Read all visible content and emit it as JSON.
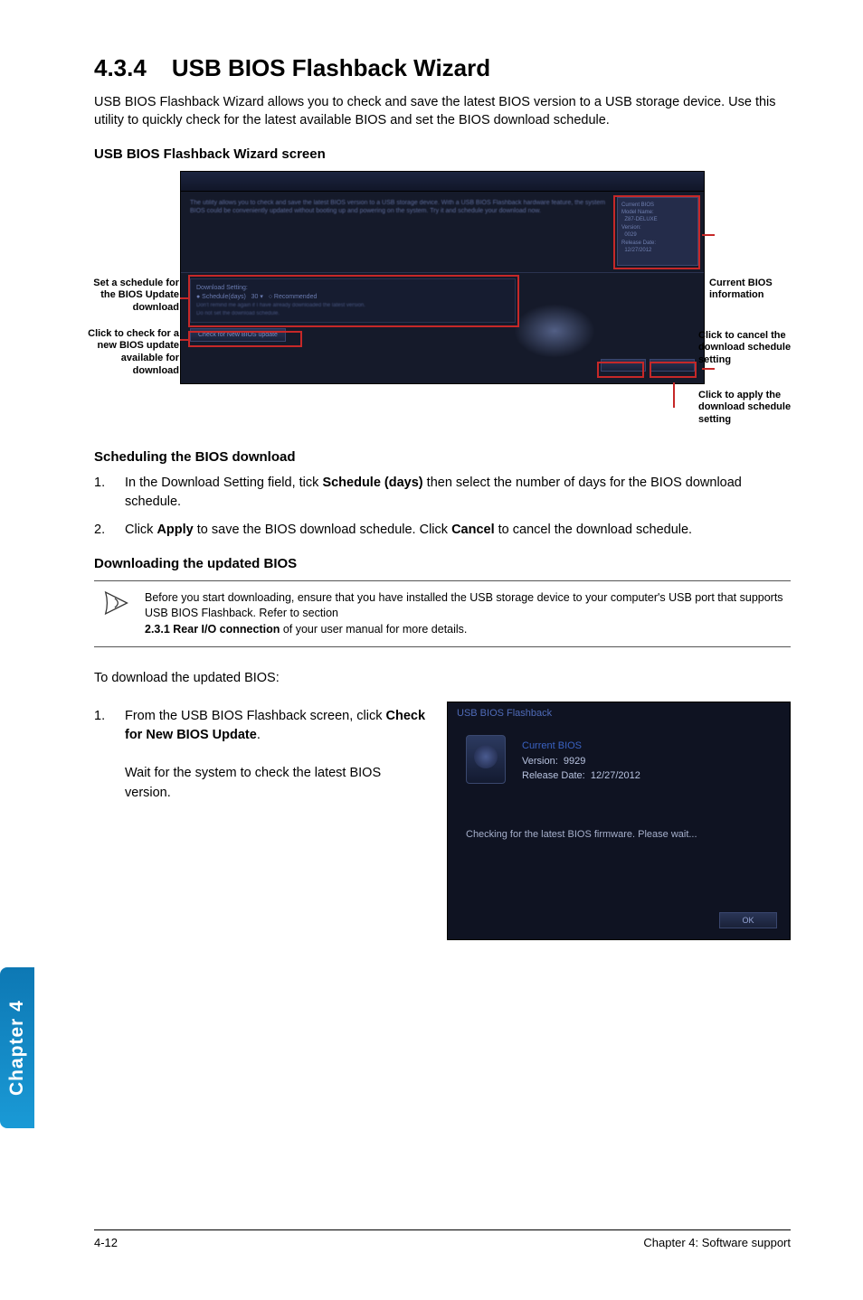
{
  "section": {
    "number": "4.3.4",
    "title": "USB BIOS Flashback Wizard",
    "intro": "USB BIOS Flashback Wizard allows you to check and save the latest BIOS version to a USB storage device. Use this utility to quickly check for the latest available BIOS and set the BIOS download schedule."
  },
  "screenshot1": {
    "heading": "USB BIOS Flashback Wizard screen",
    "labels": {
      "left1": "Set a schedule for the BIOS Update download",
      "left2": "Click to check for a new BIOS update available for download",
      "right1": "Current BIOS information",
      "right2": "Click to cancel the download schedule setting",
      "right3": "Click to apply the download schedule setting"
    }
  },
  "scheduling": {
    "heading": "Scheduling the BIOS download",
    "step1_prefix": "In the Download Setting field, tick ",
    "step1_bold": "Schedule (days)",
    "step1_suffix": " then select the number of days for the BIOS download schedule.",
    "step2_prefix": "Click ",
    "step2_apply": "Apply",
    "step2_mid": " to save the BIOS download schedule. Click ",
    "step2_cancel": "Cancel",
    "step2_suffix": " to cancel the download schedule."
  },
  "downloading": {
    "heading": "Downloading the updated BIOS",
    "note_l1": "Before you start downloading, ensure that you have installed the USB storage device to your computer's USB port that supports USB BIOS Flashback. Refer to section ",
    "note_bold": "2.3.1 Rear I/O connection",
    "note_l2": " of your user manual for more details.",
    "lead": "To download the updated BIOS:",
    "step1_prefix": "From the USB BIOS Flashback screen, click ",
    "step1_bold": "Check for New BIOS Update",
    "step1_suffix": ".",
    "step1_extra": "Wait for the system to check the latest BIOS version."
  },
  "popup": {
    "title": "USB BIOS Flashback",
    "current": "Current BIOS",
    "version_label": "Version:",
    "version_value": "9929",
    "date_label": "Release Date:",
    "date_value": "12/27/2012",
    "status": "Checking for the latest BIOS firmware. Please wait...",
    "ok": "OK"
  },
  "sidetab": "Chapter 4",
  "footer": {
    "left": "4-12",
    "right": "Chapter 4: Software support"
  }
}
